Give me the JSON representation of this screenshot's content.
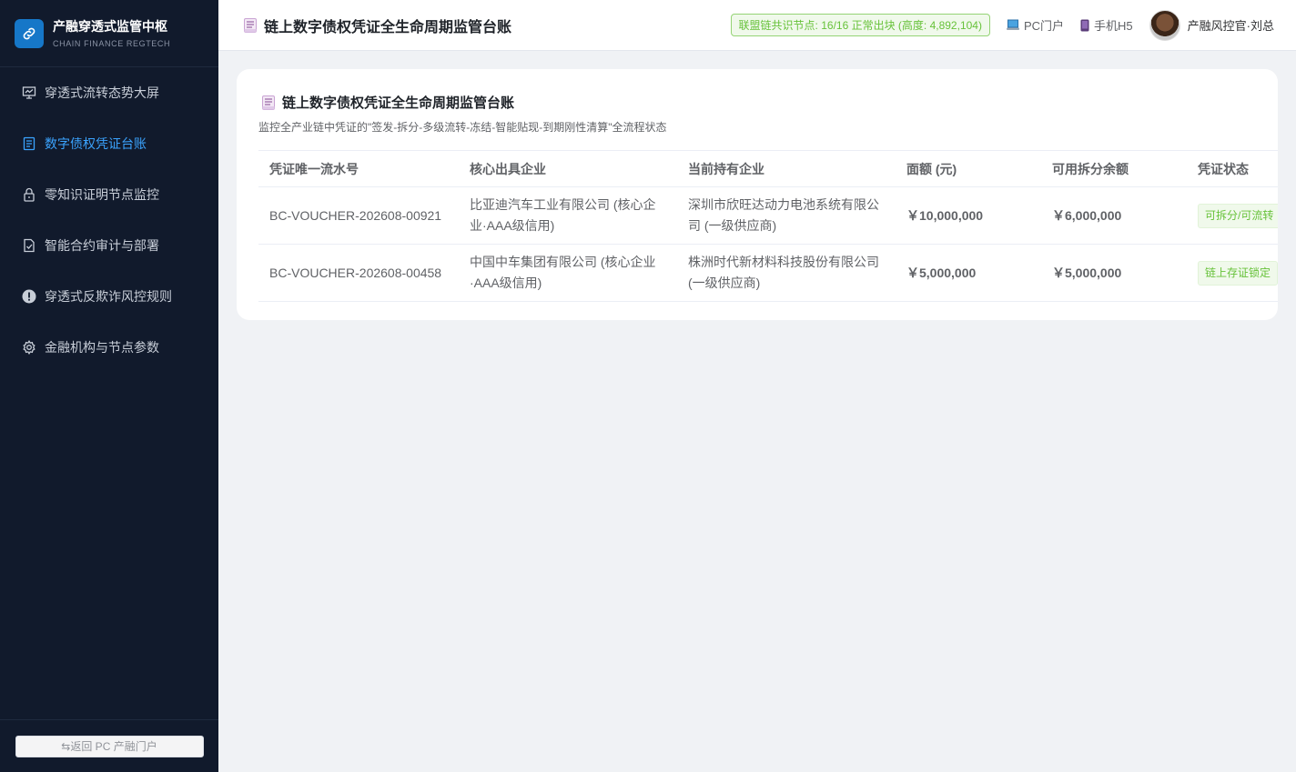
{
  "sidebar": {
    "brand_title": "产融穿透式监管中枢",
    "brand_subtitle": "CHAIN FINANCE REGTECH",
    "items": [
      {
        "label": "穿透式流转态势大屏",
        "icon": "presentation-board-icon"
      },
      {
        "label": "数字债权凭证台账",
        "icon": "document-icon",
        "active": true
      },
      {
        "label": "零知识证明节点监控",
        "icon": "lock-icon"
      },
      {
        "label": "智能合约审计与部署",
        "icon": "document-check-icon"
      },
      {
        "label": "穿透式反欺诈风控规则",
        "icon": "warning-circle-icon"
      },
      {
        "label": "金融机构与节点参数",
        "icon": "gear-icon"
      }
    ],
    "back_button": "⇆返回 PC 产融门户"
  },
  "header": {
    "title": "链上数字债权凭证全生命周期监管台账",
    "chain_status": "联盟链共识节点: 16/16 正常出块 (高度: 4,892,104)",
    "pc_portal": "PC门户",
    "mobile_h5": "手机H5",
    "user_name": "产融风控官·刘总"
  },
  "card": {
    "title": "链上数字债权凭证全生命周期监管台账",
    "subtitle": "监控全产业链中凭证的\"签发-拆分-多级流转-冻结-智能贴现-到期刚性清算\"全流程状态",
    "columns": [
      "凭证唯一流水号",
      "核心出具企业",
      "当前持有企业",
      "面额 (元)",
      "可用拆分余额",
      "凭证状态"
    ],
    "rows": [
      {
        "id": "BC-VOUCHER-202608-00921",
        "issuer": "比亚迪汽车工业有限公司 (核心企业·AAA级信用)",
        "holder": "深圳市欣旺达动力电池系统有限公司 (一级供应商)",
        "amount": "￥10,000,000",
        "available": "￥6,000,000",
        "status": "可拆分/可流转"
      },
      {
        "id": "BC-VOUCHER-202608-00458",
        "issuer": "中国中车集团有限公司 (核心企业·AAA级信用)",
        "holder": "株洲时代新材料科技股份有限公司 (一级供应商)",
        "amount": "￥5,000,000",
        "available": "￥5,000,000",
        "status": "链上存证锁定"
      }
    ]
  },
  "colors": {
    "sidebar_bg": "#111a2c",
    "accent": "#3ba4ff",
    "success": "#67c23a",
    "amount_blue": "#1e6fbf"
  }
}
